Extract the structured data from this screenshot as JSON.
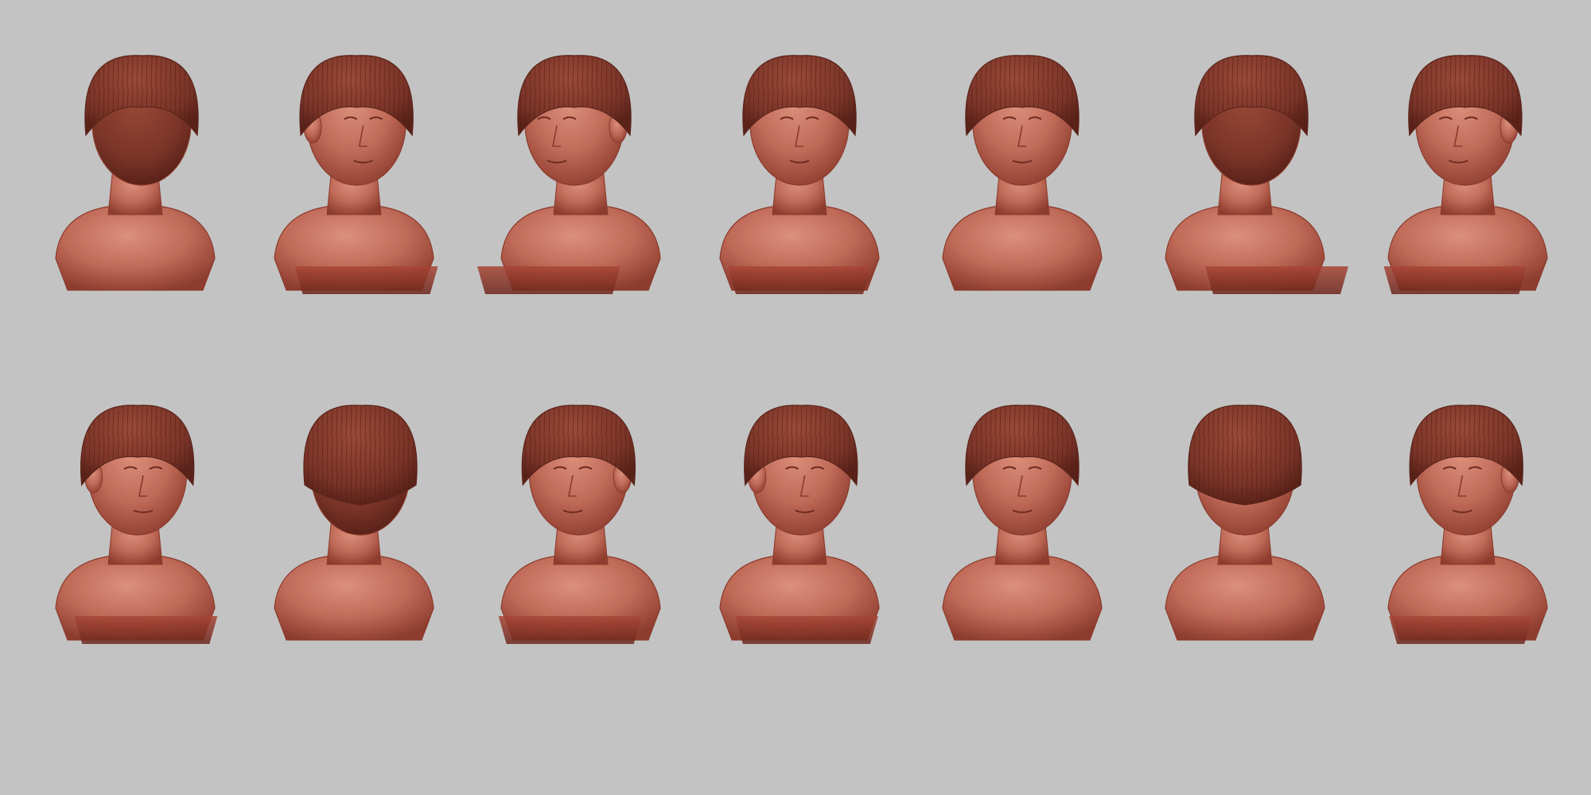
{
  "scene": {
    "background": "#c3c3c3",
    "palette": {
      "clay_light": "#cf7e6c",
      "clay_mid": "#b35f4d",
      "clay_dark": "#8b3a2c",
      "clay_deep": "#6e2a20",
      "hair": "#7c3a2c",
      "hair_dark": "#5b251b",
      "pedestal": "#9c4032",
      "pedestal_dark": "#70281e"
    },
    "rows": [
      {
        "name": "row-1",
        "busts": [
          {
            "view": "back",
            "yaw": 180
          },
          {
            "view": "three-quarter-right",
            "yaw": 35
          },
          {
            "view": "profile-left",
            "yaw": -90
          },
          {
            "view": "front-tilted-up",
            "yaw": 0
          },
          {
            "view": "front",
            "yaw": 0
          },
          {
            "view": "three-quarter-back-right",
            "yaw": 120
          },
          {
            "view": "three-quarter-left-tilted",
            "yaw": -35
          }
        ]
      },
      {
        "name": "row-2",
        "busts": [
          {
            "view": "three-quarter-right",
            "yaw": 30
          },
          {
            "view": "top-back",
            "yaw": 160
          },
          {
            "view": "three-quarter-left",
            "yaw": -30
          },
          {
            "view": "three-quarter-down",
            "yaw": 20
          },
          {
            "view": "front",
            "yaw": 0
          },
          {
            "view": "top-down",
            "yaw": 0
          },
          {
            "view": "three-quarter-left",
            "yaw": -20
          }
        ]
      }
    ]
  }
}
